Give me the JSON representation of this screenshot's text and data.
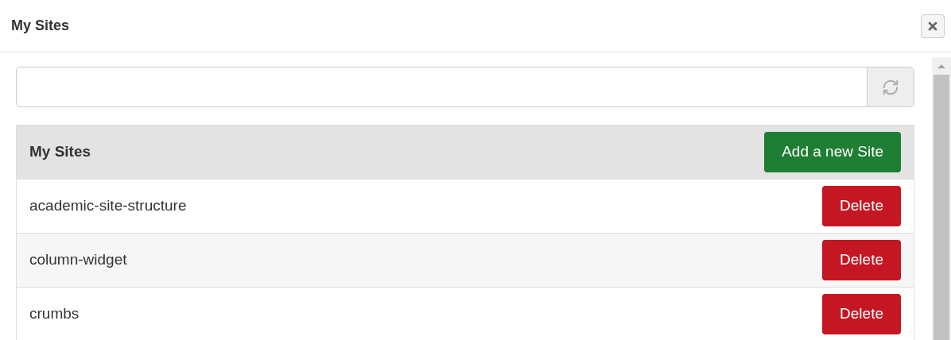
{
  "dialog": {
    "title": "My Sites"
  },
  "panel": {
    "title": "My Sites",
    "add_button": "Add a new Site"
  },
  "sites": [
    {
      "name": "academic-site-structure",
      "action": "Delete"
    },
    {
      "name": "column-widget",
      "action": "Delete"
    },
    {
      "name": "crumbs",
      "action": "Delete"
    }
  ]
}
